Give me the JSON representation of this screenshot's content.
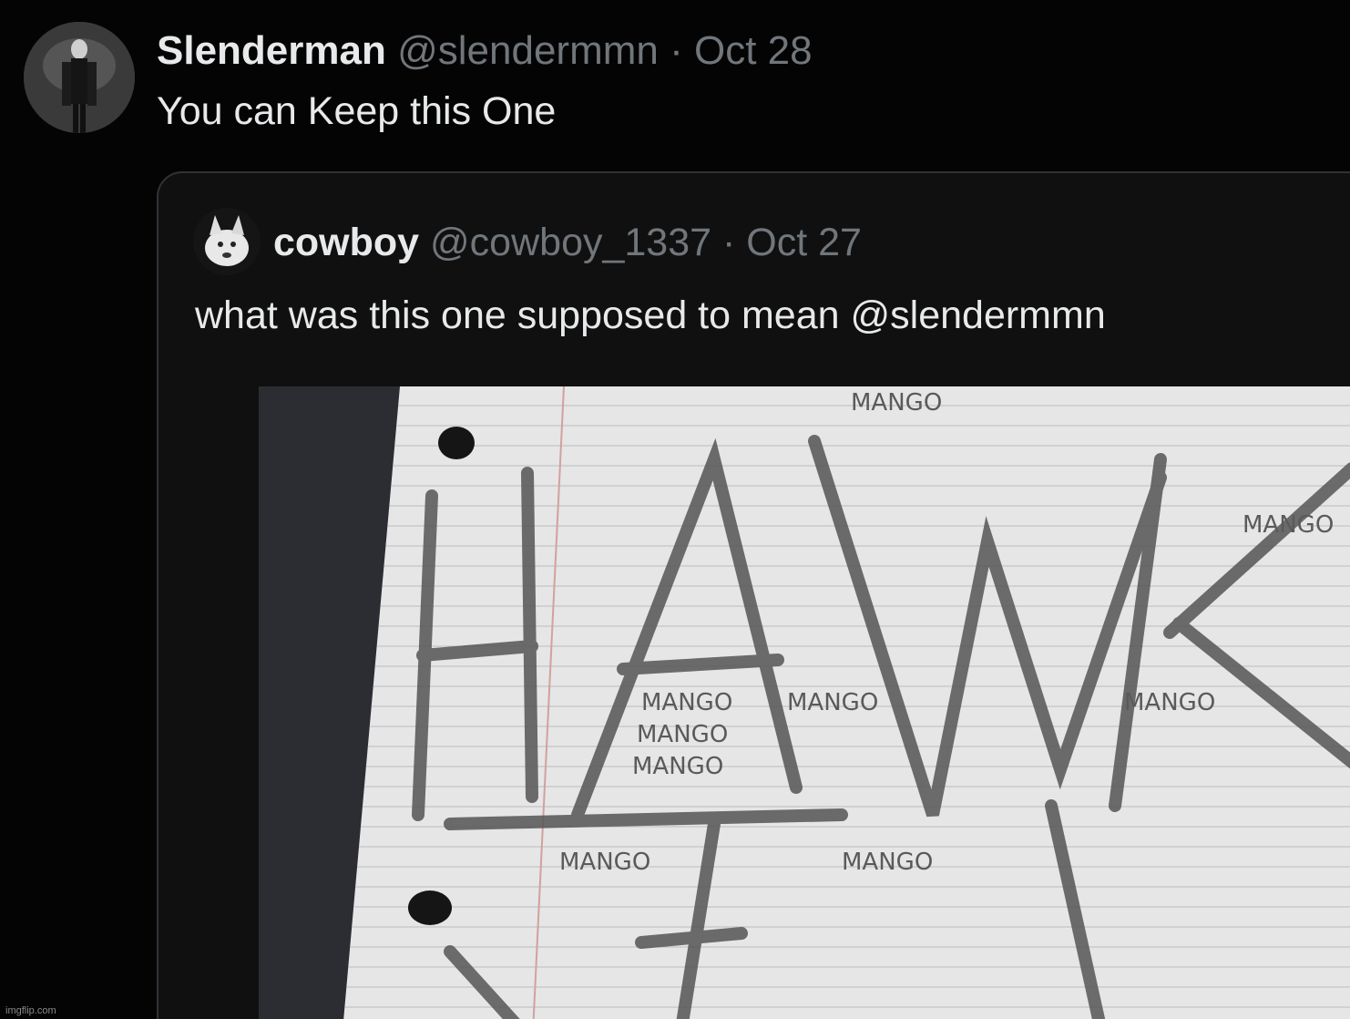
{
  "tweet": {
    "author_name": "Slenderman",
    "author_handle": "@slendermmn",
    "separator": "·",
    "date": "Oct 28",
    "text": "You can Keep this One",
    "avatar_icon": "slenderman-avatar"
  },
  "quoted_tweet": {
    "author_name": "cowboy",
    "author_handle": "@cowboy_1337",
    "separator": "·",
    "date": "Oct 27",
    "text": "what was this one supposed to mean @slendermmn",
    "avatar_icon": "dog-avatar",
    "media": {
      "description_icon": "notebook-paper-drawing",
      "scrawled_words": [
        "MANGO",
        "MANGO",
        "MANGO",
        "MANGO",
        "MANGO",
        "MANGO",
        "MANGO",
        "MANGO",
        "MANGO"
      ]
    }
  },
  "watermark": "imgflip.com",
  "colors": {
    "background": "#040404",
    "text_primary": "#e7e9ea",
    "text_secondary": "#71767b",
    "quote_border": "#2f3336"
  }
}
